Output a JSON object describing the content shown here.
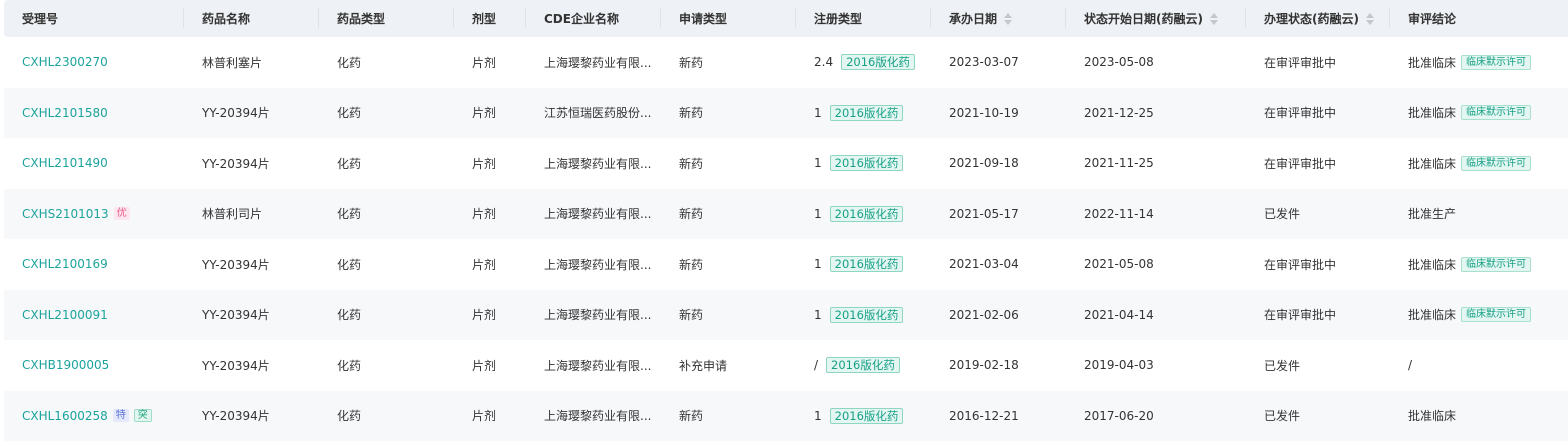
{
  "columns": {
    "receipt_no": "受理号",
    "drug_name": "药品名称",
    "drug_type": "药品类型",
    "dosage_form": "剂型",
    "company": "CDE企业名称",
    "apply_type": "申请类型",
    "reg_type": "注册类型",
    "undertake_date": "承办日期",
    "status_date": "状态开始日期(药融云)",
    "status": "办理状态(药融云)",
    "conclusion": "审评结论"
  },
  "rows": [
    {
      "receipt_no": "CXHL2300270",
      "drug_name": "林普利塞片",
      "drug_type": "化药",
      "dosage_form": "片剂",
      "company": "上海璎黎药业有限...",
      "apply_type": "新药",
      "reg_num": "2.4",
      "reg_tag": "2016版化药",
      "undertake_date": "2023-03-07",
      "status_date": "2023-05-08",
      "status": "在审评审批中",
      "conclusion": "批准临床",
      "conclusion_tag": "临床默示许可"
    },
    {
      "receipt_no": "CXHL2101580",
      "drug_name": "YY-20394片",
      "drug_type": "化药",
      "dosage_form": "片剂",
      "company": "江苏恒瑞医药股份...",
      "apply_type": "新药",
      "reg_num": "1",
      "reg_tag": "2016版化药",
      "undertake_date": "2021-10-19",
      "status_date": "2021-12-25",
      "status": "在审评审批中",
      "conclusion": "批准临床",
      "conclusion_tag": "临床默示许可"
    },
    {
      "receipt_no": "CXHL2101490",
      "drug_name": "YY-20394片",
      "drug_type": "化药",
      "dosage_form": "片剂",
      "company": "上海璎黎药业有限...",
      "apply_type": "新药",
      "reg_num": "1",
      "reg_tag": "2016版化药",
      "undertake_date": "2021-09-18",
      "status_date": "2021-11-25",
      "status": "在审评审批中",
      "conclusion": "批准临床",
      "conclusion_tag": "临床默示许可"
    },
    {
      "receipt_no": "CXHS2101013",
      "badge": "优",
      "drug_name": "林普利司片",
      "drug_type": "化药",
      "dosage_form": "片剂",
      "company": "上海璎黎药业有限...",
      "apply_type": "新药",
      "reg_num": "1",
      "reg_tag": "2016版化药",
      "undertake_date": "2021-05-17",
      "status_date": "2022-11-14",
      "status": "已发件",
      "conclusion": "批准生产"
    },
    {
      "receipt_no": "CXHL2100169",
      "drug_name": "YY-20394片",
      "drug_type": "化药",
      "dosage_form": "片剂",
      "company": "上海璎黎药业有限...",
      "apply_type": "新药",
      "reg_num": "1",
      "reg_tag": "2016版化药",
      "undertake_date": "2021-03-04",
      "status_date": "2021-05-08",
      "status": "在审评审批中",
      "conclusion": "批准临床",
      "conclusion_tag": "临床默示许可"
    },
    {
      "receipt_no": "CXHL2100091",
      "drug_name": "YY-20394片",
      "drug_type": "化药",
      "dosage_form": "片剂",
      "company": "上海璎黎药业有限...",
      "apply_type": "新药",
      "reg_num": "1",
      "reg_tag": "2016版化药",
      "undertake_date": "2021-02-06",
      "status_date": "2021-04-14",
      "status": "在审评审批中",
      "conclusion": "批准临床",
      "conclusion_tag": "临床默示许可"
    },
    {
      "receipt_no": "CXHB1900005",
      "drug_name": "YY-20394片",
      "drug_type": "化药",
      "dosage_form": "片剂",
      "company": "上海璎黎药业有限...",
      "apply_type": "补充申请",
      "reg_num": "/",
      "reg_tag": "2016版化药",
      "undertake_date": "2019-02-18",
      "status_date": "2019-04-03",
      "status": "已发件",
      "conclusion": "/"
    },
    {
      "receipt_no": "CXHL1600258",
      "badge": "特",
      "badge2": "突",
      "drug_name": "YY-20394片",
      "drug_type": "化药",
      "dosage_form": "片剂",
      "company": "上海璎黎药业有限...",
      "apply_type": "新药",
      "reg_num": "1",
      "reg_tag": "2016版化药",
      "undertake_date": "2016-12-21",
      "status_date": "2017-06-20",
      "status": "已发件",
      "conclusion": "批准临床"
    }
  ]
}
